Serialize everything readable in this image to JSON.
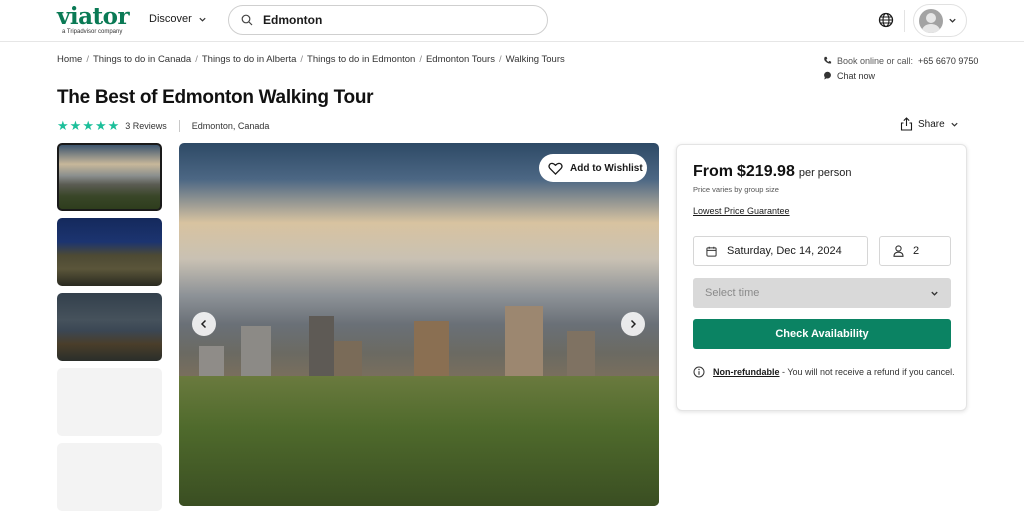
{
  "header": {
    "logo_text": "viator",
    "logo_subtext": "a Tripadvisor company",
    "discover_label": "Discover",
    "search_value": "Edmonton",
    "search_placeholder": "Search"
  },
  "breadcrumb": [
    "Home",
    "Things to do in Canada",
    "Things to do in Alberta",
    "Things to do in Edmonton",
    "Edmonton Tours",
    "Walking Tours"
  ],
  "contact": {
    "book_label": "Book online or call:",
    "phone": "+65 6670 9750",
    "chat_label": "Chat now"
  },
  "product": {
    "title": "The Best of Edmonton Walking Tour",
    "rating": 5,
    "reviews_label": "3 Reviews",
    "location": "Edmonton, Canada",
    "share_label": "Share",
    "wishlist_label": "Add to Wishlist"
  },
  "gallery": {
    "thumbnails": [
      "Edmonton skyline",
      "Hotel Macdonald",
      "River valley dusk",
      "",
      ""
    ],
    "selected_index": 0,
    "main_image": "Edmonton downtown skyline with clouds and High Level Bridge"
  },
  "booking": {
    "price_prefix": "From",
    "price": "$219.98",
    "price_suffix": "per person",
    "price_note": "Price varies by group size",
    "guarantee_label": "Lowest Price Guarantee",
    "date_value": "Saturday, Dec 14, 2024",
    "travelers_value": "2",
    "time_placeholder": "Select time",
    "check_label": "Check Availability",
    "refund_title": "Non-refundable",
    "refund_text": " - You will not receive a refund if you cancel."
  },
  "colors": {
    "brand_green": "#0a7a55",
    "star_green": "#1cbf9a",
    "button_green": "#0b8363"
  }
}
